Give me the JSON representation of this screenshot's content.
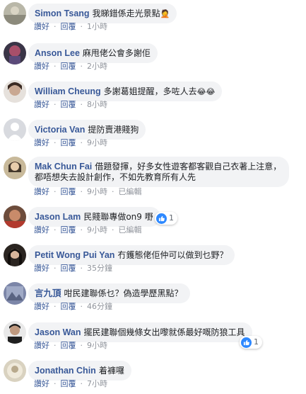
{
  "labels": {
    "like": "讚好",
    "reply": "回覆",
    "edited": "已編輯"
  },
  "comments": [
    {
      "author": "Simon Tsang",
      "text": "我睇錯係走光景點",
      "emoji": "🤦",
      "time": "1小時"
    },
    {
      "author": "Anson Lee",
      "text": "麻甩佬公會多謝佢",
      "time": "2小時"
    },
    {
      "author": "William Cheung",
      "text": "多謝葛姐提醒，多咗人去",
      "emoji": "😂😂",
      "time": "8小時"
    },
    {
      "author": "Victoria Van",
      "text": "提防賣港賤狗",
      "time": "9小時"
    },
    {
      "author": "Mak Chun Fai",
      "text": "借題發揮，好多女性遊客都客觀自己衣著上注意，都唔想失去設計創作，不如先教育所有人先",
      "time": "9小時"
    },
    {
      "author": "Jason Lam",
      "text": "民賤聯專做on9 嘢",
      "time": "9小時",
      "reactions": "1"
    },
    {
      "author": "Petit Wong Pui Yan",
      "text": "冇鑊態佬佢仲可以做到乜野？",
      "time": "35分鐘"
    },
    {
      "author": "言九頂",
      "text": "咁民建聯係乜？偽造學歷黑點？",
      "time": "46分鐘"
    },
    {
      "author": "Jason Wan",
      "text": "擺民建聯個幾條女出嚟就係最好嘅防狼工具",
      "time": "9小時",
      "reactions": "1"
    },
    {
      "author": "Jonathan Chin",
      "text": "着褲囉",
      "time": "7小時"
    }
  ]
}
